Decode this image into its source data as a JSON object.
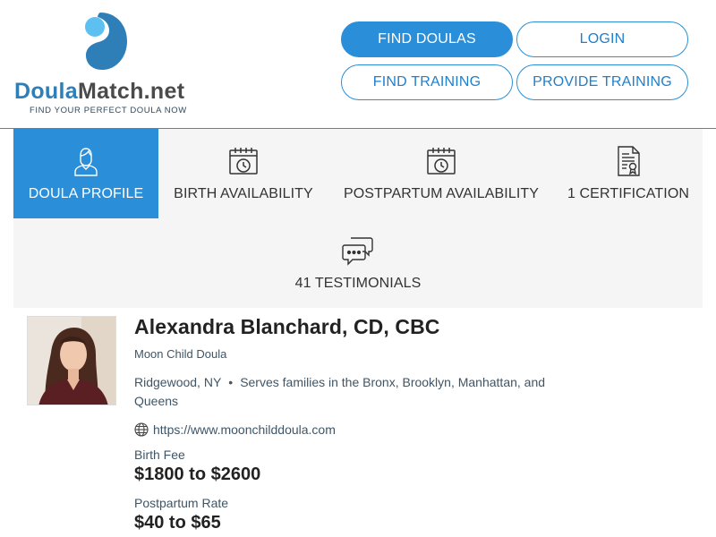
{
  "brand": {
    "name_part1": "Doula",
    "name_part2": "Match.net",
    "tagline": "FIND YOUR PERFECT DOULA NOW",
    "colors": {
      "primary": "#2b8ed9",
      "logo_blue": "#2e7fb8",
      "logo_light": "#5cc0f0"
    }
  },
  "nav": {
    "find_doulas": "FIND DOULAS",
    "login": "LOGIN",
    "find_training": "FIND TRAINING",
    "provide_training": "PROVIDE TRAINING"
  },
  "tabs": [
    {
      "label": "DOULA PROFILE",
      "icon": "person-icon",
      "active": true
    },
    {
      "label": "BIRTH AVAILABILITY",
      "icon": "calendar-clock-icon",
      "active": false
    },
    {
      "label": "POSTPARTUM AVAILABILITY",
      "icon": "calendar-clock-icon",
      "active": false
    },
    {
      "label": "1 CERTIFICATION",
      "icon": "certificate-icon",
      "active": false
    },
    {
      "label": "41 TESTIMONIALS",
      "icon": "chat-bubbles-icon",
      "active": false
    }
  ],
  "profile": {
    "name": "Alexandra Blanchard, CD, CBC",
    "business": "Moon Child Doula",
    "location": "Ridgewood, NY",
    "separator": "•",
    "serves": "Serves families in the Bronx, Brooklyn, Manhattan, and Queens",
    "website": "https://www.moonchilddoula.com",
    "birth_fee_label": "Birth Fee",
    "birth_fee": "$1800 to $2600",
    "postpartum_label": "Postpartum Rate",
    "postpartum_rate": "$40 to $65"
  }
}
